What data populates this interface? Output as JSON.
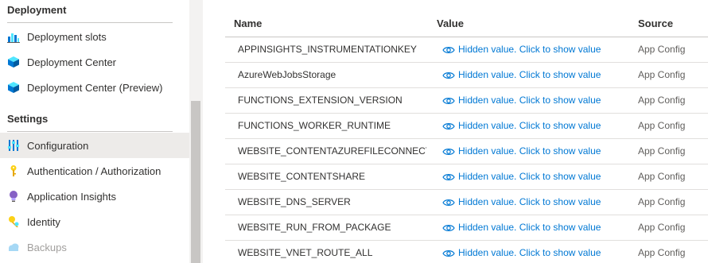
{
  "sidebar": {
    "sections": [
      {
        "title": "Deployment"
      },
      {
        "title": "Settings"
      }
    ],
    "items": [
      {
        "label": "Deployment slots",
        "icon": "deployment-slots-icon"
      },
      {
        "label": "Deployment Center",
        "icon": "cube-icon"
      },
      {
        "label": "Deployment Center (Preview)",
        "icon": "cube-icon"
      },
      {
        "label": "Configuration",
        "icon": "sliders-icon",
        "selected": true
      },
      {
        "label": "Authentication / Authorization",
        "icon": "key-icon"
      },
      {
        "label": "Application Insights",
        "icon": "lightbulb-icon"
      },
      {
        "label": "Identity",
        "icon": "identity-key-icon"
      },
      {
        "label": "Backups",
        "icon": "cloud-icon",
        "disabled": true
      }
    ]
  },
  "table": {
    "headers": {
      "name": "Name",
      "value": "Value",
      "source": "Source"
    },
    "rows": [
      {
        "name": "APPINSIGHTS_INSTRUMENTATIONKEY",
        "value": "Hidden value. Click to show value",
        "source": "App Config"
      },
      {
        "name": "AzureWebJobsStorage",
        "value": "Hidden value. Click to show value",
        "source": "App Config"
      },
      {
        "name": "FUNCTIONS_EXTENSION_VERSION",
        "value": "Hidden value. Click to show value",
        "source": "App Config"
      },
      {
        "name": "FUNCTIONS_WORKER_RUNTIME",
        "value": "Hidden value. Click to show value",
        "source": "App Config"
      },
      {
        "name": "WEBSITE_CONTENTAZUREFILECONNECTIONSTRING",
        "value": "Hidden value. Click to show value",
        "source": "App Config"
      },
      {
        "name": "WEBSITE_CONTENTSHARE",
        "value": "Hidden value. Click to show value",
        "source": "App Config"
      },
      {
        "name": "WEBSITE_DNS_SERVER",
        "value": "Hidden value. Click to show value",
        "source": "App Config"
      },
      {
        "name": "WEBSITE_RUN_FROM_PACKAGE",
        "value": "Hidden value. Click to show value",
        "source": "App Config"
      },
      {
        "name": "WEBSITE_VNET_ROUTE_ALL",
        "value": "Hidden value. Click to show value",
        "source": "App Config"
      }
    ]
  },
  "colors": {
    "link": "#0078d4",
    "selected_bg": "#edebe9",
    "accent_blue": "#0078d4",
    "key_yellow": "#fcd116",
    "insights_purple": "#8661c5"
  }
}
